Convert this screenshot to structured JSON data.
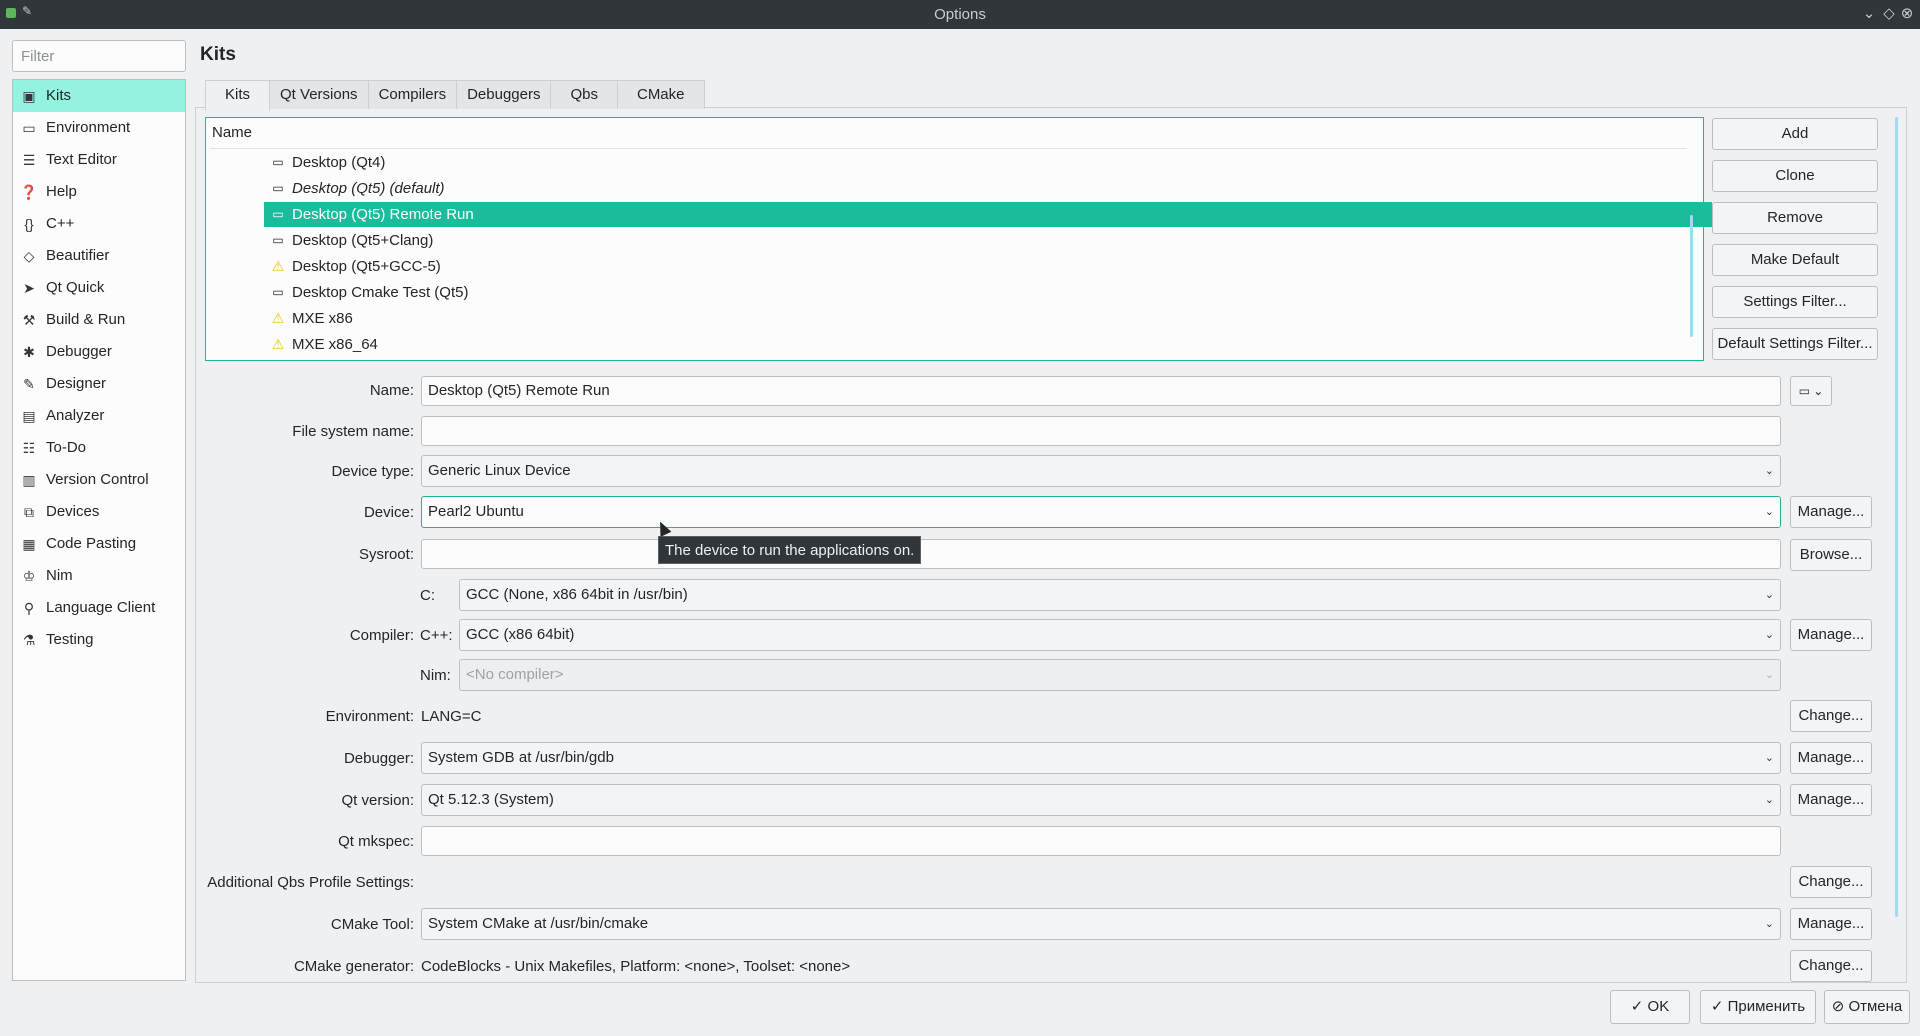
{
  "window": {
    "title": "Options"
  },
  "sidebar": {
    "filter_placeholder": "Filter",
    "items": [
      {
        "label": "Kits",
        "icon": "kits-icon"
      },
      {
        "label": "Environment",
        "icon": "monitor-icon"
      },
      {
        "label": "Text Editor",
        "icon": "text-editor-icon"
      },
      {
        "label": "Help",
        "icon": "help-icon"
      },
      {
        "label": "C++",
        "icon": "braces-icon"
      },
      {
        "label": "Beautifier",
        "icon": "diamond-icon"
      },
      {
        "label": "Qt Quick",
        "icon": "paper-plane-icon"
      },
      {
        "label": "Build & Run",
        "icon": "hammer-icon"
      },
      {
        "label": "Debugger",
        "icon": "bug-icon"
      },
      {
        "label": "Designer",
        "icon": "pencil-icon"
      },
      {
        "label": "Analyzer",
        "icon": "analyzer-icon"
      },
      {
        "label": "To-Do",
        "icon": "list-icon"
      },
      {
        "label": "Version Control",
        "icon": "version-control-icon"
      },
      {
        "label": "Devices",
        "icon": "devices-icon"
      },
      {
        "label": "Code Pasting",
        "icon": "clipboard-icon"
      },
      {
        "label": "Nim",
        "icon": "nim-icon"
      },
      {
        "label": "Language Client",
        "icon": "language-client-icon"
      },
      {
        "label": "Testing",
        "icon": "flask-icon"
      }
    ]
  },
  "main": {
    "heading": "Kits",
    "tabs": [
      "Kits",
      "Qt Versions",
      "Compilers",
      "Debuggers",
      "Qbs",
      "CMake"
    ],
    "tree": {
      "header": "Name",
      "rows": [
        {
          "label": "Desktop (Qt4)",
          "icon": "monitor",
          "style": "normal"
        },
        {
          "label": "Desktop (Qt5) (default)",
          "icon": "monitor",
          "style": "italic"
        },
        {
          "label": "Desktop (Qt5) Remote Run",
          "icon": "monitor",
          "style": "selected"
        },
        {
          "label": "Desktop (Qt5+Clang)",
          "icon": "monitor",
          "style": "normal"
        },
        {
          "label": "Desktop (Qt5+GCC-5)",
          "icon": "warning",
          "style": "normal"
        },
        {
          "label": "Desktop Cmake Test (Qt5)",
          "icon": "monitor",
          "style": "normal"
        },
        {
          "label": "MXE x86",
          "icon": "warning",
          "style": "normal"
        },
        {
          "label": "MXE x86_64",
          "icon": "warning",
          "style": "normal"
        }
      ]
    },
    "side_buttons": {
      "add": "Add",
      "clone": "Clone",
      "remove": "Remove",
      "make_default": "Make Default",
      "settings_filter": "Settings Filter...",
      "default_settings_filter": "Default Settings Filter..."
    },
    "form": {
      "name_label": "Name:",
      "name_value": "Desktop (Qt5) Remote Run",
      "fs_name_label": "File system name:",
      "fs_name_value": "",
      "device_type_label": "Device type:",
      "device_type_value": "Generic Linux Device",
      "device_label": "Device:",
      "device_value": "Pearl2 Ubuntu",
      "sysroot_label": "Sysroot:",
      "sysroot_value": "",
      "compiler_label": "Compiler:",
      "c_label": "C:",
      "c_value": "GCC (None, x86 64bit in /usr/bin)",
      "cpp_label": "C++:",
      "cpp_value": "GCC (x86 64bit)",
      "nim_label": "Nim:",
      "nim_value": "<No compiler>",
      "environment_label": "Environment:",
      "environment_value": "LANG=C",
      "debugger_label": "Debugger:",
      "debugger_value": "System GDB at /usr/bin/gdb",
      "qt_version_label": "Qt version:",
      "qt_version_value": "Qt 5.12.3 (System)",
      "qt_mkspec_label": "Qt mkspec:",
      "qt_mkspec_value": "",
      "qbs_label": "Additional Qbs Profile Settings:",
      "cmake_tool_label": "CMake Tool:",
      "cmake_tool_value": "System CMake at /usr/bin/cmake",
      "cmake_gen_label": "CMake generator:",
      "cmake_gen_value": "CodeBlocks - Unix Makefiles, Platform: <none>, Toolset: <none>",
      "manage": "Manage...",
      "browse": "Browse...",
      "change": "Change..."
    },
    "tooltip": "The device to run the applications on."
  },
  "footer": {
    "ok": "OK",
    "apply": "Применить",
    "cancel": "Отмена"
  },
  "colors": {
    "accent": "#1abc9c",
    "sidebar_active": "#93f3e0",
    "titlebar": "#31363b",
    "warning": "#f1c40f"
  }
}
